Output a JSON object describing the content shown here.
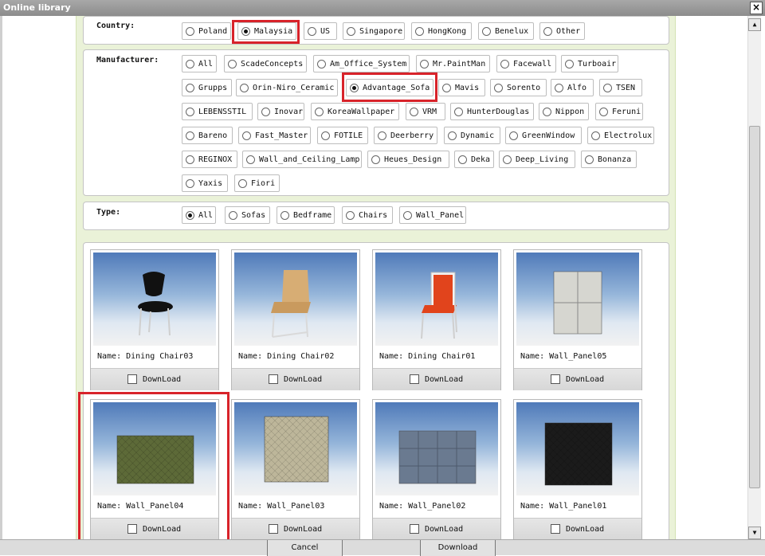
{
  "window": {
    "title": "Online library",
    "close_label": "×"
  },
  "country": {
    "label": "Country:",
    "options": [
      "Poland",
      "Malaysia",
      "US",
      "Singapore",
      "HongKong",
      "Benelux",
      "Other"
    ],
    "selected": "Malaysia"
  },
  "manufacturer": {
    "label": "Manufacturer:",
    "options": [
      "All",
      "ScadeConcepts",
      "Am_Office_System",
      "Mr.PaintMan",
      "Facewall",
      "Turboair",
      "Grupps",
      "Orin-Niro_Ceramic",
      "Advantage_Sofa",
      "Mavis",
      "Sorento",
      "Alfo",
      "TSEN",
      "LEBENSSTIL",
      "Inovar",
      "KoreaWallpaper",
      "VRM",
      "HunterDouglas",
      "Nippon",
      "Feruni",
      "Bareno",
      "Fast_Master",
      "FOTILE",
      "Deerberry",
      "Dynamic",
      "GreenWindow",
      "Electrolux",
      "REGINOX",
      "Wall_and_Ceiling_Lamp",
      "Heues_Design",
      "Deka",
      "Deep_Living",
      "Bonanza",
      "Yaxis",
      "Fiori"
    ],
    "selected": "Advantage_Sofa"
  },
  "type": {
    "label": "Type:",
    "options": [
      "All",
      "Sofas",
      "Bedframe",
      "Chairs",
      "Wall_Panel"
    ],
    "selected": "All"
  },
  "items": [
    {
      "name": "Name: Dining Chair03",
      "download": "DownLoad",
      "kind": "chair-black"
    },
    {
      "name": "Name: Dining Chair02",
      "download": "DownLoad",
      "kind": "chair-beige"
    },
    {
      "name": "Name: Dining Chair01",
      "download": "DownLoad",
      "kind": "chair-red"
    },
    {
      "name": "Name: Wall_Panel05",
      "download": "DownLoad",
      "kind": "panel-grey-quilt"
    },
    {
      "name": "Name: Wall_Panel04",
      "download": "DownLoad",
      "kind": "panel-green"
    },
    {
      "name": "Name: Wall_Panel03",
      "download": "DownLoad",
      "kind": "panel-beige"
    },
    {
      "name": "Name: Wall_Panel02",
      "download": "DownLoad",
      "kind": "panel-blue"
    },
    {
      "name": "Name: Wall_Panel01",
      "download": "DownLoad",
      "kind": "panel-black"
    }
  ],
  "footer": {
    "cancel_label": "Cancel",
    "download_label": "Download"
  },
  "colors": {
    "highlight": "#d8232a",
    "panel_bg": "#eaf2d8"
  }
}
